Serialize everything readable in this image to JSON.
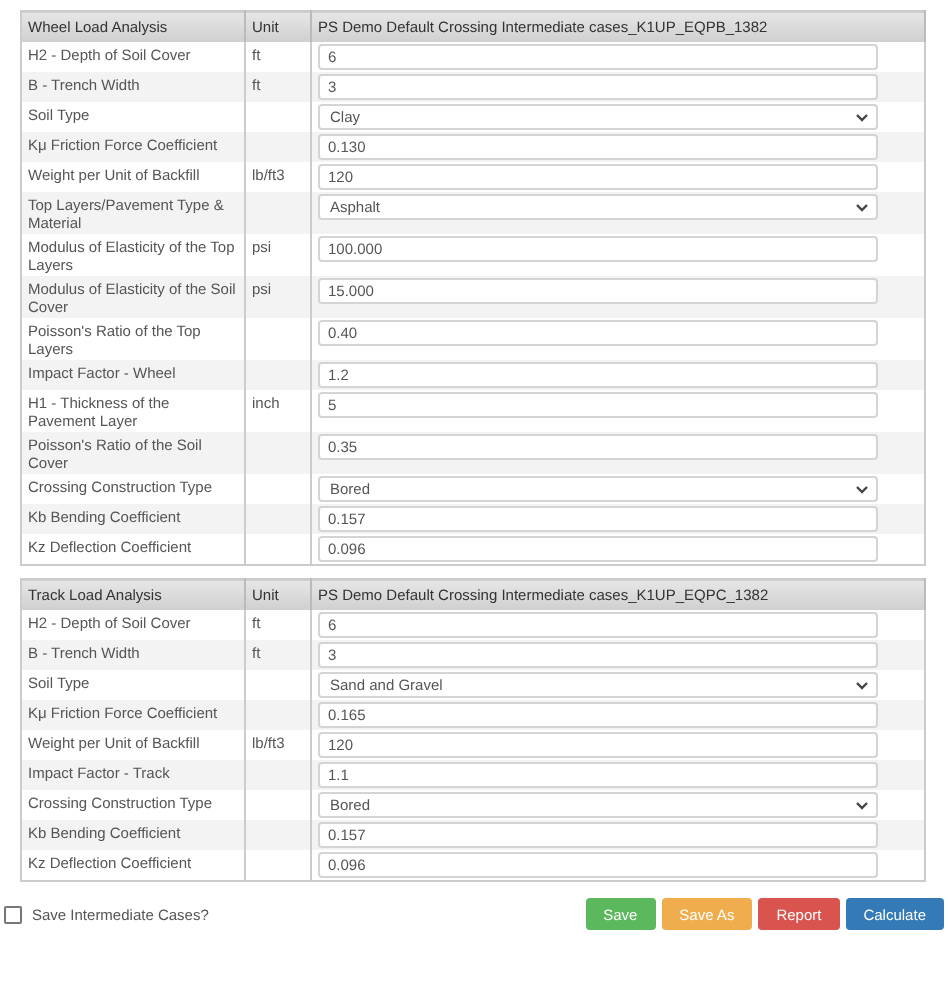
{
  "tables": [
    {
      "header": {
        "label": "Wheel Load Analysis",
        "unit": "Unit",
        "case": "PS Demo Default Crossing Intermediate cases_K1UP_EQPB_1382"
      },
      "rows": [
        {
          "label": "H2 - Depth of Soil Cover",
          "unit": "ft",
          "kind": "input",
          "value": "6"
        },
        {
          "label": "B - Trench Width",
          "unit": "ft",
          "kind": "input",
          "value": "3"
        },
        {
          "label": "Soil Type",
          "kind": "select",
          "value": "Clay"
        },
        {
          "label": "Kμ Friction Force Coefficient",
          "kind": "input",
          "value": "0.130"
        },
        {
          "label": "Weight per Unit of Backfill",
          "unit": "lb/ft3",
          "kind": "input",
          "value": "120"
        },
        {
          "label": "Top Layers/Pavement Type & Material",
          "kind": "select",
          "value": "Asphalt"
        },
        {
          "label": "Modulus of Elasticity of the Top Layers",
          "unit": "psi",
          "kind": "input",
          "value": "100.000"
        },
        {
          "label": "Modulus of Elasticity of the Soil Cover",
          "unit": "psi",
          "kind": "input",
          "value": "15.000"
        },
        {
          "label": "Poisson's Ratio of the Top Layers",
          "kind": "input",
          "value": "0.40"
        },
        {
          "label": "Impact Factor - Wheel",
          "kind": "input",
          "value": "1.2"
        },
        {
          "label": "H1 - Thickness of the Pavement Layer",
          "unit": "inch",
          "kind": "input",
          "value": "5"
        },
        {
          "label": "Poisson's Ratio of the Soil Cover",
          "kind": "input",
          "value": "0.35"
        },
        {
          "label": "Crossing Construction Type",
          "kind": "select",
          "value": "Bored"
        },
        {
          "label": "Kb Bending Coefficient",
          "kind": "input",
          "value": "0.157"
        },
        {
          "label": "Kz Deflection Coefficient",
          "kind": "input",
          "value": "0.096"
        }
      ]
    },
    {
      "header": {
        "label": "Track Load Analysis",
        "unit": "Unit",
        "case": "PS Demo Default Crossing Intermediate cases_K1UP_EQPC_1382"
      },
      "rows": [
        {
          "label": "H2 - Depth of Soil Cover",
          "unit": "ft",
          "kind": "input",
          "value": "6"
        },
        {
          "label": "B - Trench Width",
          "unit": "ft",
          "kind": "input",
          "value": "3"
        },
        {
          "label": "Soil Type",
          "kind": "select",
          "value": "Sand and Gravel"
        },
        {
          "label": "Kμ Friction Force Coefficient",
          "kind": "input",
          "value": "0.165"
        },
        {
          "label": "Weight per Unit of Backfill",
          "unit": "lb/ft3",
          "kind": "input",
          "value": "120"
        },
        {
          "label": "Impact Factor - Track",
          "kind": "input",
          "value": "1.1"
        },
        {
          "label": "Crossing Construction Type",
          "kind": "select",
          "value": "Bored"
        },
        {
          "label": "Kb Bending Coefficient",
          "kind": "input",
          "value": "0.157"
        },
        {
          "label": "Kz Deflection Coefficient",
          "kind": "input",
          "value": "0.096"
        }
      ]
    }
  ],
  "save_intermediate": {
    "label": "Save Intermediate Cases?",
    "checked": false
  },
  "buttons": [
    {
      "label": "Save",
      "kind": "success"
    },
    {
      "label": "Save As",
      "kind": "warning"
    },
    {
      "label": "Report",
      "kind": "danger"
    },
    {
      "label": "Calculate",
      "kind": "primary"
    }
  ]
}
